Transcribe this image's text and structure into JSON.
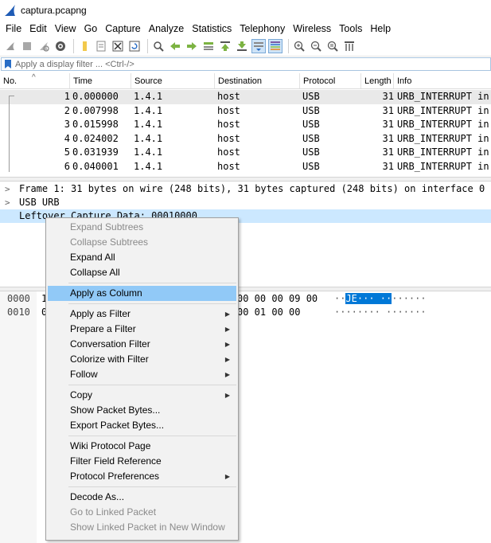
{
  "window": {
    "title": "captura.pcapng"
  },
  "menubar": [
    "File",
    "Edit",
    "View",
    "Go",
    "Capture",
    "Analyze",
    "Statistics",
    "Telephony",
    "Wireless",
    "Tools",
    "Help"
  ],
  "toolbar": {
    "icons": [
      "start-capture-icon",
      "stop-capture-icon",
      "restart-capture-icon",
      "capture-options-icon",
      "open-file-icon",
      "save-file-icon",
      "close-file-icon",
      "reload-file-icon",
      "find-packet-icon",
      "go-back-icon",
      "go-forward-icon",
      "go-to-packet-icon",
      "go-first-icon",
      "go-last-icon",
      "auto-scroll-icon",
      "colorize-icon",
      "zoom-in-icon",
      "zoom-out-icon",
      "zoom-normal-icon",
      "resize-columns-icon"
    ]
  },
  "filter": {
    "placeholder": "Apply a display filter ... <Ctrl-/>"
  },
  "packet_list": {
    "columns": [
      "No.",
      "Time",
      "Source",
      "Destination",
      "Protocol",
      "Length",
      "Info"
    ],
    "rows": [
      {
        "no": "1",
        "time": "0.000000",
        "source": "1.4.1",
        "destination": "host",
        "protocol": "USB",
        "length": "31",
        "info": "URB_INTERRUPT in"
      },
      {
        "no": "2",
        "time": "0.007998",
        "source": "1.4.1",
        "destination": "host",
        "protocol": "USB",
        "length": "31",
        "info": "URB_INTERRUPT in"
      },
      {
        "no": "3",
        "time": "0.015998",
        "source": "1.4.1",
        "destination": "host",
        "protocol": "USB",
        "length": "31",
        "info": "URB_INTERRUPT in"
      },
      {
        "no": "4",
        "time": "0.024002",
        "source": "1.4.1",
        "destination": "host",
        "protocol": "USB",
        "length": "31",
        "info": "URB_INTERRUPT in"
      },
      {
        "no": "5",
        "time": "0.031939",
        "source": "1.4.1",
        "destination": "host",
        "protocol": "USB",
        "length": "31",
        "info": "URB_INTERRUPT in"
      },
      {
        "no": "6",
        "time": "0.040001",
        "source": "1.4.1",
        "destination": "host",
        "protocol": "USB",
        "length": "31",
        "info": "URB_INTERRUPT in"
      }
    ]
  },
  "details": {
    "frame": "Frame 1: 31 bytes on wire (248 bits), 31 bytes captured (248 bits) on interface 0",
    "usb": "USB URB",
    "leftover": "Leftover Capture Data: 00010000"
  },
  "bytes": {
    "rows": [
      {
        "offset": "0000",
        "hex_left": "1",
        "hex_right": "00 00 00 09 00",
        "ascii_pre": "··",
        "ascii_hi": "JE··· ··",
        "ascii_post": "······"
      },
      {
        "offset": "0010",
        "hex_left": "0",
        "hex_right": "00 01 00 00",
        "ascii_pre": "········ ·······",
        "ascii_hi": "",
        "ascii_post": ""
      }
    ]
  },
  "context_menu": {
    "items": [
      {
        "label": "Expand Subtrees",
        "disabled": true
      },
      {
        "label": "Collapse Subtrees",
        "disabled": true
      },
      {
        "label": "Expand All"
      },
      {
        "label": "Collapse All"
      },
      {
        "separator": true
      },
      {
        "label": "Apply as Column",
        "hover": true
      },
      {
        "separator": true
      },
      {
        "label": "Apply as Filter",
        "submenu": true
      },
      {
        "label": "Prepare a Filter",
        "submenu": true
      },
      {
        "label": "Conversation Filter",
        "submenu": true
      },
      {
        "label": "Colorize with Filter",
        "submenu": true
      },
      {
        "label": "Follow",
        "submenu": true
      },
      {
        "separator": true
      },
      {
        "label": "Copy",
        "submenu": true
      },
      {
        "label": "Show Packet Bytes..."
      },
      {
        "label": "Export Packet Bytes..."
      },
      {
        "separator": true
      },
      {
        "label": "Wiki Protocol Page"
      },
      {
        "label": "Filter Field Reference"
      },
      {
        "label": "Protocol Preferences",
        "submenu": true
      },
      {
        "separator": true
      },
      {
        "label": "Decode As..."
      },
      {
        "label": "Go to Linked Packet",
        "disabled": true
      },
      {
        "label": "Show Linked Packet in New Window",
        "disabled": true
      }
    ]
  },
  "colors": {
    "selection": "#cce8ff",
    "menu_hover": "#91c9f7",
    "bytes_highlight": "#0078d7",
    "shark_fin": "#1e5bb5"
  }
}
